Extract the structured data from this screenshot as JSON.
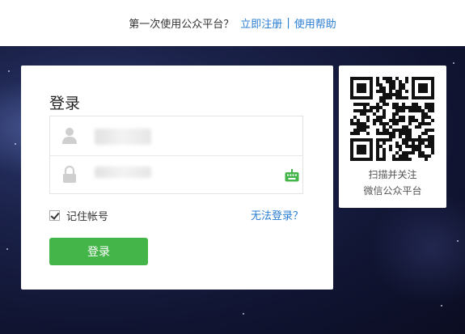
{
  "topbar": {
    "question": "第一次使用公众平台？",
    "register": "立即注册",
    "separator": "|",
    "help": "使用帮助"
  },
  "login": {
    "title": "登录",
    "remember_label": "记住帐号",
    "remember_checked": true,
    "forgot": "无法登录？",
    "button": "登录"
  },
  "qr": {
    "line1": "扫描并关注",
    "line2": "微信公众平台"
  },
  "icons": {
    "user": "user-icon",
    "lock": "lock-icon",
    "keyboard": "keyboard-icon",
    "check": "check-icon"
  },
  "colors": {
    "link": "#2a7ed3",
    "button": "#44b549",
    "keyboard_icon": "#44b549"
  }
}
